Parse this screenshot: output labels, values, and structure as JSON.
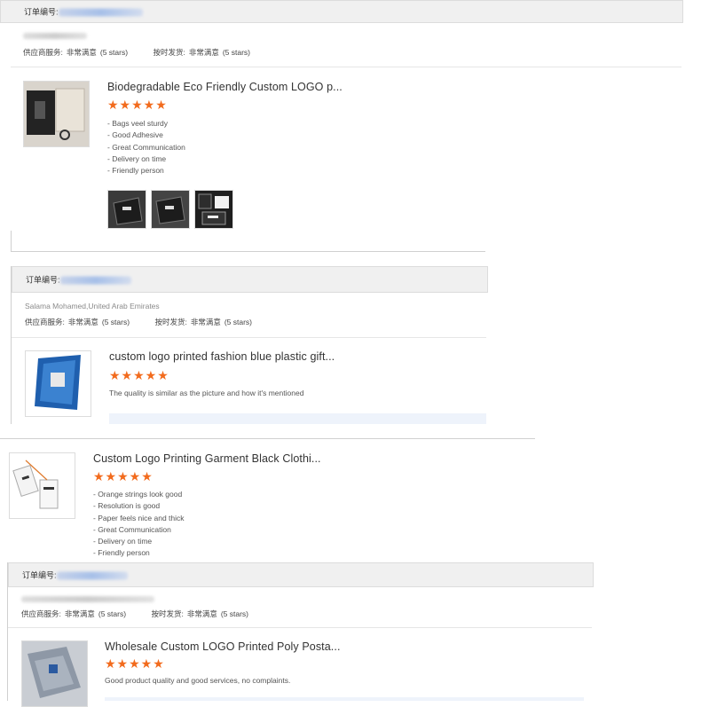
{
  "labels": {
    "order_no": "订单编号:",
    "supplier_service": "供应商服务:",
    "on_time_shipping": "按时发货:",
    "very_satisfied": "非常满意",
    "five_stars": "(5 stars)"
  },
  "stars": "★★★★★",
  "colors": {
    "star": "#f26b1d",
    "header_bg": "#f0f0f0"
  },
  "orders": [
    {
      "order_prefix": "订单编号:",
      "buyer": "",
      "product_title": "Biodegradable Eco Friendly Custom LOGO p...",
      "review_lines": [
        "- Bags veel sturdy",
        "- Good Adhesive",
        "- Great Communication",
        "- Delivery on time",
        "- Friendly person"
      ],
      "photos": [
        "black-bag-photo",
        "black-bag-photo",
        "printed-bag-photo"
      ]
    },
    {
      "order_prefix": "订单编号:",
      "buyer": "Salama Mohamed,United Arab Emirates",
      "product_title": "custom logo printed fashion blue plastic gift...",
      "review_lines": [
        "The quality is similar as the picture and how it's mentioned"
      ]
    },
    {
      "product_title": "Custom Logo Printing Garment Black Clothi...",
      "review_lines": [
        "- Orange strings look good",
        "- Resolution is good",
        "- Paper feels nice and thick",
        "- Great Communication",
        "- Delivery on time",
        "- Friendly person"
      ]
    },
    {
      "order_prefix": "订单编号:",
      "buyer": "",
      "product_title": "Wholesale Custom LOGO Printed Poly Posta...",
      "review_lines": [
        "Good product quality and good services, no complaints."
      ]
    }
  ]
}
